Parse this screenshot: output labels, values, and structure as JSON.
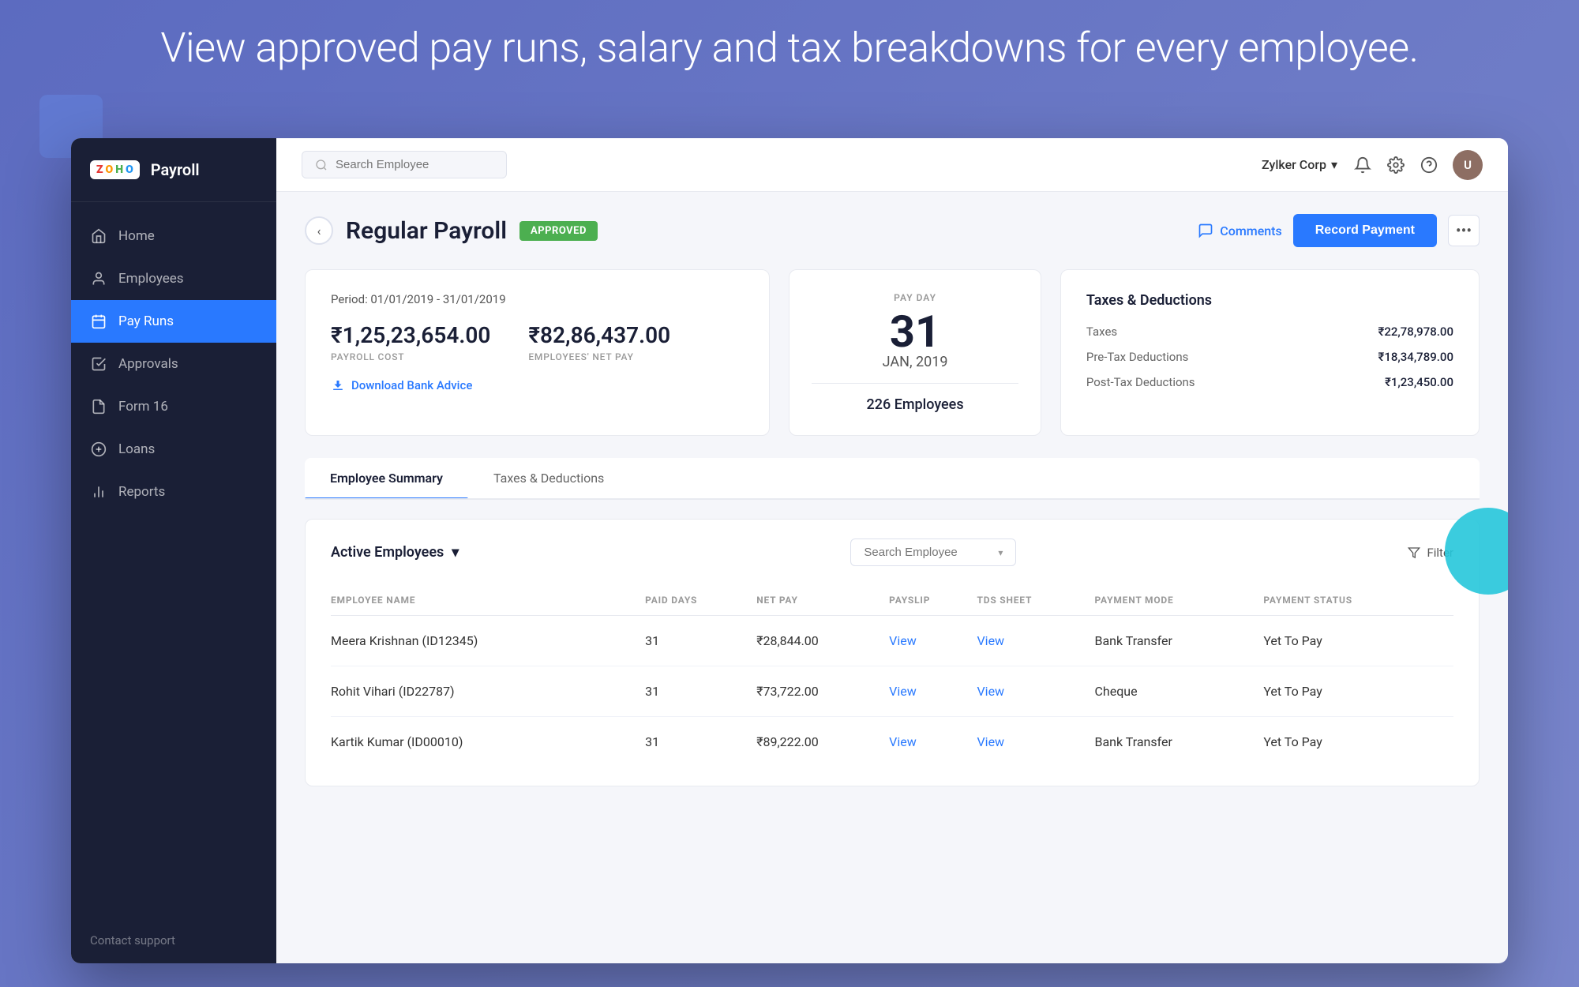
{
  "hero": {
    "text": "View approved pay runs, salary and tax breakdowns for every employee."
  },
  "sidebar": {
    "logo": {
      "z": "Z",
      "o": "O",
      "h": "H",
      "o2": "O",
      "payroll": "Payroll"
    },
    "nav": [
      {
        "id": "home",
        "label": "Home",
        "icon": "home"
      },
      {
        "id": "employees",
        "label": "Employees",
        "icon": "person"
      },
      {
        "id": "payruns",
        "label": "Pay Runs",
        "icon": "calendar",
        "active": true
      },
      {
        "id": "approvals",
        "label": "Approvals",
        "icon": "check-square"
      },
      {
        "id": "form16",
        "label": "Form 16",
        "icon": "file"
      },
      {
        "id": "loans",
        "label": "Loans",
        "icon": "dollar-circle"
      },
      {
        "id": "reports",
        "label": "Reports",
        "icon": "bar-chart"
      }
    ],
    "footer": "Contact support"
  },
  "topbar": {
    "search_placeholder": "Search Employee",
    "company": "Zylker Corp",
    "avatar_initials": "U"
  },
  "page": {
    "back_label": "‹",
    "title": "Regular Payroll",
    "badge": "APPROVED",
    "comments_label": "Comments",
    "record_payment_label": "Record Payment",
    "more_icon": "•••"
  },
  "payroll_card": {
    "period": "Period: 01/01/2019 - 31/01/2019",
    "payroll_cost": "₹1,25,23,654.00",
    "payroll_cost_label": "PAYROLL COST",
    "net_pay": "₹82,86,437.00",
    "net_pay_label": "EMPLOYEES' NET PAY",
    "download_label": "Download Bank Advice"
  },
  "payday_card": {
    "label": "PAY DAY",
    "day": "31",
    "month": "JAN, 2019",
    "employees": "226 Employees"
  },
  "taxes_card": {
    "title": "Taxes & Deductions",
    "rows": [
      {
        "name": "Taxes",
        "value": "₹22,78,978.00"
      },
      {
        "name": "Pre-Tax Deductions",
        "value": "₹18,34,789.00"
      },
      {
        "name": "Post-Tax Deductions",
        "value": "₹1,23,450.00"
      }
    ]
  },
  "tabs": [
    {
      "id": "employee-summary",
      "label": "Employee Summary",
      "active": true
    },
    {
      "id": "taxes-deductions",
      "label": "Taxes & Deductions",
      "active": false
    }
  ],
  "table": {
    "active_employees_label": "Active Employees",
    "search_placeholder": "Search Employee",
    "filter_label": "Filter",
    "columns": [
      "EMPLOYEE NAME",
      "PAID DAYS",
      "NET PAY",
      "PAYSLIP",
      "TDS SHEET",
      "PAYMENT MODE",
      "PAYMENT STATUS"
    ],
    "rows": [
      {
        "name": "Meera Krishnan (ID12345)",
        "paid_days": "31",
        "net_pay": "₹28,844.00",
        "payslip": "View",
        "tds_sheet": "View",
        "payment_mode": "Bank Transfer",
        "payment_status": "Yet To Pay"
      },
      {
        "name": "Rohit Vihari (ID22787)",
        "paid_days": "31",
        "net_pay": "₹73,722.00",
        "payslip": "View",
        "tds_sheet": "View",
        "payment_mode": "Cheque",
        "payment_status": "Yet To Pay"
      },
      {
        "name": "Kartik Kumar (ID00010)",
        "paid_days": "31",
        "net_pay": "₹89,222.00",
        "payslip": "View",
        "tds_sheet": "View",
        "payment_mode": "Bank Transfer",
        "payment_status": "Yet To Pay"
      }
    ]
  }
}
